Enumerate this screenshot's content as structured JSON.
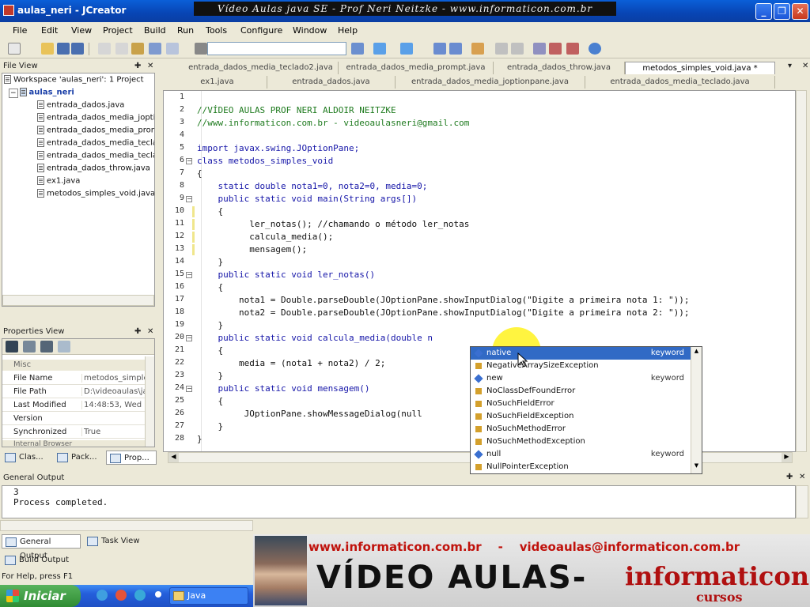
{
  "window": {
    "title": "aulas_neri - JCreator",
    "overlay_title": "Vídeo Aulas java SE - Prof Neri Neitzke - www.informaticon.com.br"
  },
  "menu": [
    "File",
    "Edit",
    "View",
    "Project",
    "Build",
    "Run",
    "Tools",
    "Configure",
    "Window",
    "Help"
  ],
  "file_view": {
    "title": "File View",
    "workspace": "Workspace 'aulas_neri': 1 Project",
    "project": "aulas_neri",
    "files": [
      "entrada_dados.java",
      "entrada_dados_media_joptio",
      "entrada_dados_media_prom",
      "entrada_dados_media_tecla",
      "entrada_dados_media_tecla",
      "entrada_dados_throw.java",
      "ex1.java",
      "metodos_simples_void.java"
    ]
  },
  "properties_view": {
    "title": "Properties View",
    "section": "Misc",
    "rows": [
      {
        "name": "File Name",
        "value": "metodos_simples"
      },
      {
        "name": "File Path",
        "value": "D:\\videoaulas\\ja"
      },
      {
        "name": "Last Modified",
        "value": "14:48:53, Wed"
      },
      {
        "name": "Version",
        "value": ""
      },
      {
        "name": "Synchronized",
        "value": "True"
      }
    ],
    "section2": "Internal Browser",
    "tabs": [
      "Clas...",
      "Pack...",
      "Prop..."
    ]
  },
  "editor_tabs": {
    "row1": [
      "entrada_dados_media_teclado2.java",
      "entrada_dados_media_prompt.java",
      "entrada_dados_throw.java",
      "metodos_simples_void.java *"
    ],
    "row2": [
      "ex1.java",
      "entrada_dados.java",
      "entrada_dados_media_joptionpane.java",
      "entrada_dados_media_teclado.java"
    ]
  },
  "code": {
    "line_numbers": [
      "1",
      "2",
      "3",
      "4",
      "5",
      "6",
      "7",
      "8",
      "9",
      "10",
      "11",
      "12",
      "13",
      "14",
      "15",
      "16",
      "17",
      "18",
      "19",
      "20",
      "21",
      "22",
      "23",
      "24",
      "25",
      "26",
      "27",
      "28"
    ],
    "lines": [
      "",
      "//VÍDEO AULAS PROF NERI ALDOIR NEITZKE",
      "//www.informaticon.com.br - videoaulasneri@gmail.com",
      "",
      "import javax.swing.JOptionPane;",
      "class metodos_simples_void",
      "{",
      "    static double nota1=0, nota2=0, media=0;",
      "    public static void main(String args[])",
      "    {",
      "          ler_notas(); //chamando o método ler_notas",
      "          calcula_media();",
      "          mensagem();",
      "    }",
      "    public static void ler_notas()",
      "    {",
      "        nota1 = Double.parseDouble(JOptionPane.showInputDialog(\"Digite a primeira nota 1: \"));",
      "        nota2 = Double.parseDouble(JOptionPane.showInputDialog(\"Digite a primeira nota 2: \"));",
      "    }",
      "    public static void calcula_media(double n",
      "    {",
      "        media = (nota1 + nota2) / 2;",
      "    }",
      "    public static void mensagem()",
      "    {",
      "         JOptionPane.showMessageDialog(null",
      "    }",
      "}"
    ]
  },
  "autocomplete": {
    "items": [
      {
        "label": "native",
        "kind": "keyword",
        "icon": "keyword",
        "selected": true
      },
      {
        "label": "NegativeArraySizeException",
        "kind": "",
        "icon": "class"
      },
      {
        "label": "new",
        "kind": "keyword",
        "icon": "keyword"
      },
      {
        "label": "NoClassDefFoundError",
        "kind": "",
        "icon": "class"
      },
      {
        "label": "NoSuchFieldError",
        "kind": "",
        "icon": "class"
      },
      {
        "label": "NoSuchFieldException",
        "kind": "",
        "icon": "class"
      },
      {
        "label": "NoSuchMethodError",
        "kind": "",
        "icon": "class"
      },
      {
        "label": "NoSuchMethodException",
        "kind": "",
        "icon": "class"
      },
      {
        "label": "null",
        "kind": "keyword",
        "icon": "keyword"
      },
      {
        "label": "NullPointerException",
        "kind": "",
        "icon": "class"
      }
    ]
  },
  "output": {
    "title": "General Output",
    "lines": [
      "3",
      "Process completed."
    ],
    "tabs": [
      "General Output",
      "Task View",
      "Build Output"
    ]
  },
  "status": "For Help, press F1",
  "taskbar": {
    "start": "Iniciar",
    "task": "Java"
  },
  "banner": {
    "site": "www.informaticon.com.br",
    "dash": "-",
    "email": "videoaulas@informaticon.com.br",
    "title": "VÍDEO AULAS-",
    "brand": "informaticon",
    "sub": "cursos"
  },
  "colors": {
    "title_bar": "#0a5fd8",
    "selection": "#316ac5",
    "comment": "#1e7a1e",
    "keyword": "#1515a8",
    "banner_red": "#c0120c",
    "highlight": "#fff000"
  }
}
